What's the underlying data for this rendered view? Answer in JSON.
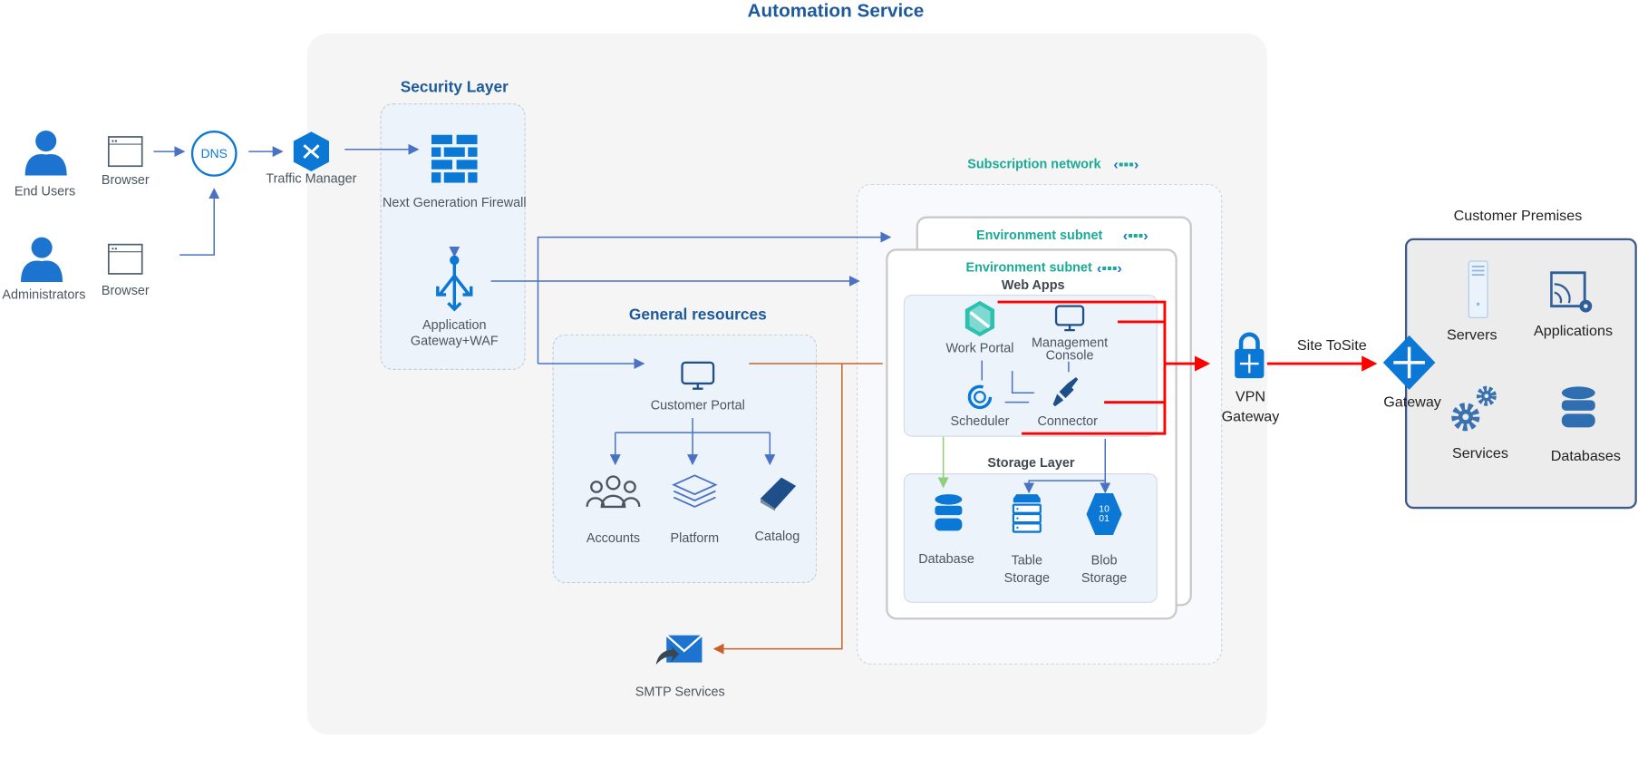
{
  "title": "Automation Service",
  "actors": {
    "end_users": "End Users",
    "administrators": "Administrators",
    "browser1": "Browser",
    "browser2": "Browser"
  },
  "dns": "DNS",
  "traffic_manager": "Traffic Manager",
  "security_layer": {
    "title": "Security Layer",
    "firewall": "Next Generation Firewall",
    "app_gateway": "Application Gateway+WAF"
  },
  "general_resources": {
    "title": "General resources",
    "customer_portal": "Customer Portal",
    "accounts": "Accounts",
    "platform": "Platform",
    "catalog": "Catalog"
  },
  "smtp": "SMTP Services",
  "subscription_network": "Subscription network",
  "env_subnet_back": "Environment subnet",
  "env_subnet_front": "Environment subnet",
  "web_apps": {
    "title": "Web Apps",
    "work_portal": "Work Portal",
    "management_console": "Management Console",
    "scheduler": "Scheduler",
    "connector": "Connector"
  },
  "storage": {
    "title": "Storage Layer",
    "database": "Database",
    "table_storage": "Table Storage",
    "blob_storage": "Blob Storage",
    "blob_glyph": "10 01"
  },
  "vpn_gateway": "VPN Gateway",
  "site_to_site": "Site ToSite",
  "gateway": "Gateway",
  "customer_premises": {
    "title": "Customer Premises",
    "servers": "Servers",
    "applications": "Applications",
    "services": "Services",
    "databases": "Databases"
  },
  "colors": {
    "brand": "#1d5a9c",
    "icon_blue": "#0a78d4",
    "teal": "#1aaa96",
    "red": "#ff0000",
    "orange": "#c8622a",
    "green": "#8fcf7a",
    "line_blue": "#4a72c4"
  }
}
